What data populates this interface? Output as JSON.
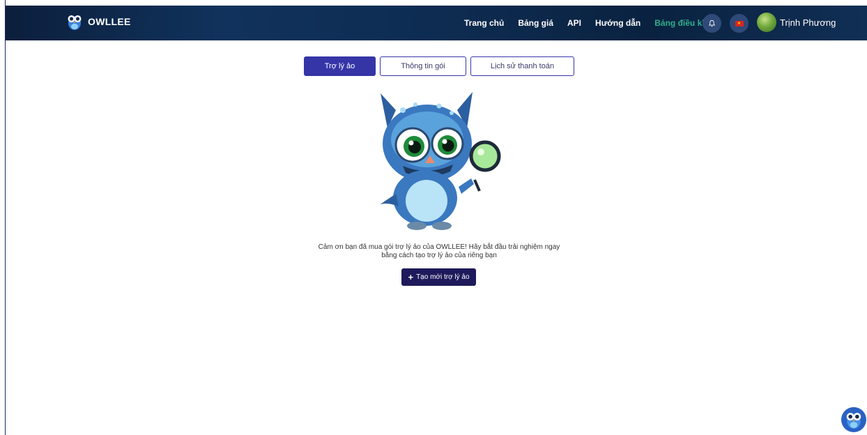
{
  "brand": {
    "name": "OWLLEE",
    "logo_icon": "owl-logo-icon"
  },
  "nav": {
    "links": [
      {
        "label": "Trang chủ"
      },
      {
        "label": "Bảng giá"
      },
      {
        "label": "API"
      },
      {
        "label": "Hướng dẫn"
      },
      {
        "label": "Bảng điều khiển",
        "active": true
      }
    ],
    "notification_icon": "bell-icon",
    "language_icon": "vietnam-flag-icon",
    "user_name": "Trịnh Phương"
  },
  "tabs": [
    {
      "label": "Trợ lý ảo",
      "active": true
    },
    {
      "label": "Thông tin gói"
    },
    {
      "label": "Lịch sử thanh toán"
    }
  ],
  "empty_state": {
    "message_line1": "Cảm ơn bạn đã mua gói trợ lý ảo của OWLLEE! Hãy bắt đầu trải nghiệm ngay",
    "message_line2": "bằng cách tạo trợ lý ảo của riêng bạn",
    "create_button_icon": "+",
    "create_button_label": "Tạo mới trợ lý ảo"
  },
  "colors": {
    "nav_bg": "#0e2c52",
    "active_nav": "#2fb08a",
    "tab_active": "#3535a8",
    "button_bg": "#1e1a5c"
  }
}
